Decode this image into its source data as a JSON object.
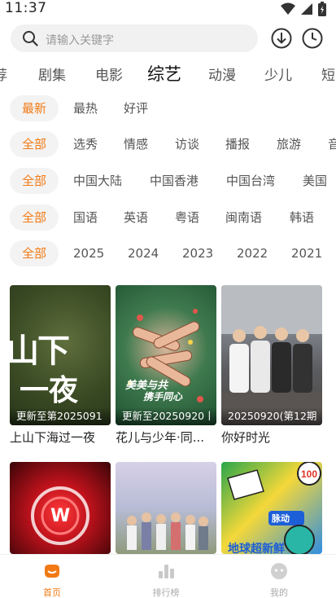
{
  "status_bar": {
    "time": "11:37"
  },
  "search": {
    "placeholder": "请输入关键字"
  },
  "tabs": [
    "荐",
    "剧集",
    "电影",
    "综艺",
    "动漫",
    "少儿",
    "短"
  ],
  "active_tab": "综艺",
  "filters": {
    "sort": [
      "最新",
      "最热",
      "好评"
    ],
    "type": [
      "全部",
      "选秀",
      "情感",
      "访谈",
      "播报",
      "旅游",
      "音"
    ],
    "region": [
      "全部",
      "中国大陆",
      "中国香港",
      "中国台湾",
      "美国"
    ],
    "language": [
      "全部",
      "国语",
      "英语",
      "粤语",
      "闽南语",
      "韩语"
    ],
    "year": [
      "全部",
      "2025",
      "2024",
      "2023",
      "2022",
      "2021"
    ]
  },
  "cards": [
    {
      "badge": "更新至第2025091",
      "title": "上山下海过一夜"
    },
    {
      "badge": "更新至20250920丨",
      "title": "花儿与少年·同..."
    },
    {
      "badge": "20250920(第12期",
      "title": "你好时光"
    },
    {
      "badge": "",
      "title": ""
    },
    {
      "badge": "",
      "title": ""
    },
    {
      "badge": "",
      "title": ""
    }
  ],
  "card_texts": [
    "山下",
    "一夜",
    "美美与共",
    "携手同心",
    "W",
    "脉动",
    "地球超新鲜"
  ],
  "bottom_nav": [
    {
      "label": "首页",
      "icon": "home-icon"
    },
    {
      "label": "排行榜",
      "icon": "ranking-icon"
    },
    {
      "label": "我的",
      "icon": "profile-icon"
    }
  ],
  "colors": {
    "accent": "#f27a14",
    "chip_bg": "#f3f3f3",
    "search_bg": "#f1f1f1"
  }
}
